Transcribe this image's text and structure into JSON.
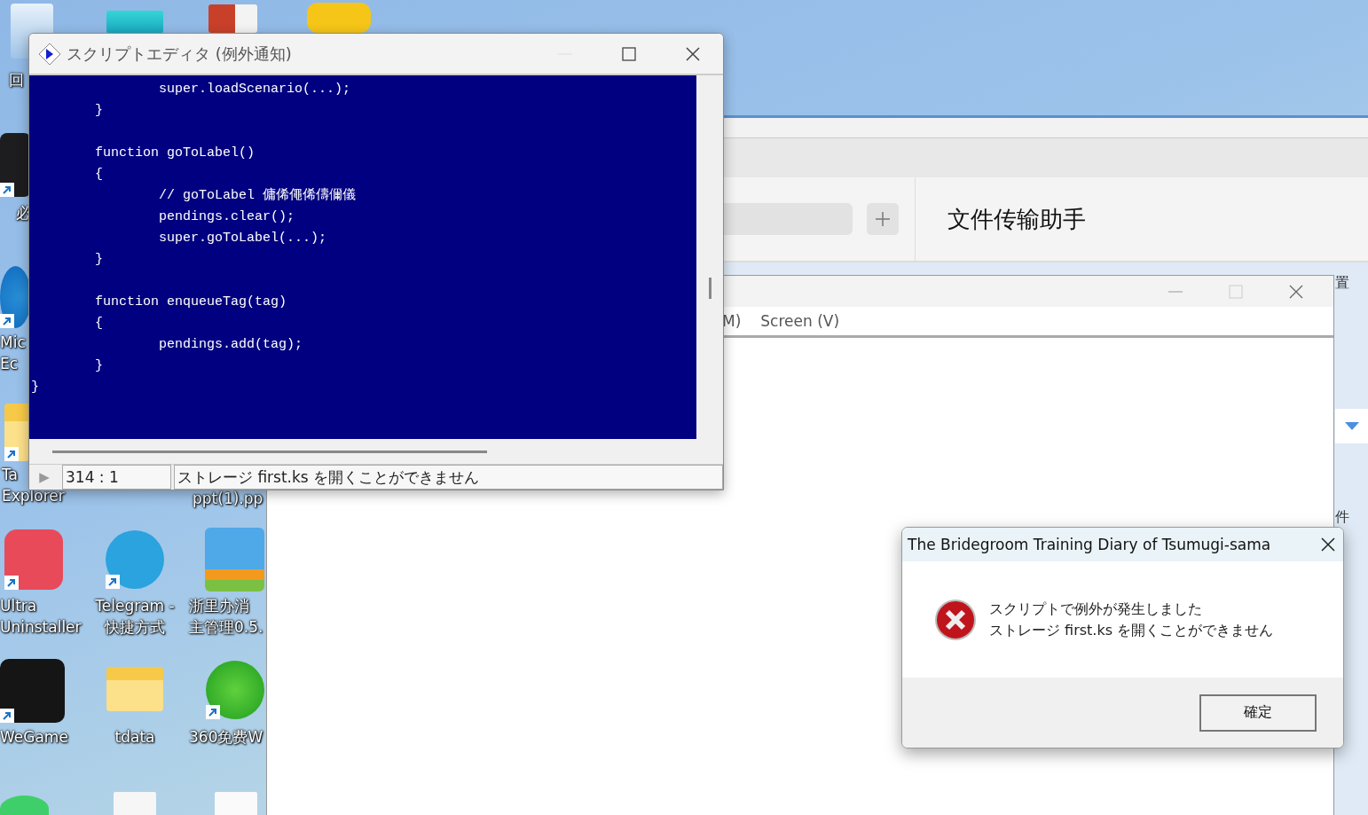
{
  "desktop_icons": [
    {
      "kind": "recycle-bin",
      "label_lines": [
        "回"
      ],
      "shortcut": false
    },
    {
      "kind": "tile",
      "shortcut": false
    },
    {
      "kind": "slides",
      "shortcut": false
    },
    {
      "kind": "stack",
      "shortcut": false
    },
    {
      "kind": "dark-app",
      "label_lines": [
        "必"
      ],
      "shortcut": true
    },
    {
      "kind": "browser",
      "label_lines": [
        "Mic",
        "Ec"
      ],
      "shortcut": true
    },
    {
      "kind": "folder",
      "label_lines": [
        "Ta",
        "Explorer"
      ],
      "shortcut": true
    },
    {
      "kind": "none",
      "label_lines": [
        "ppt(1).pp"
      ]
    },
    {
      "kind": "bolt",
      "label_lines": [
        "Ultra",
        "Uninstaller"
      ],
      "shortcut": true
    },
    {
      "kind": "plane",
      "label_lines": [
        "Telegram -",
        "快捷方式"
      ],
      "shortcut": true
    },
    {
      "kind": "zip",
      "label_lines": [
        "浙里办消",
        "主管理0.5."
      ],
      "shortcut": false
    },
    {
      "kind": "game",
      "label_lines": [
        "WeGame"
      ],
      "shortcut": true
    },
    {
      "kind": "folder",
      "label_lines": [
        "tdata"
      ],
      "shortcut": false
    },
    {
      "kind": "wifi",
      "label_lines": [
        "360免费W"
      ],
      "shortcut": true
    },
    {
      "kind": "chat",
      "shortcut": false
    },
    {
      "kind": "document",
      "shortcut": false
    },
    {
      "kind": "sheet",
      "shortcut": false
    }
  ],
  "chat_window": {
    "title": "文件传输助手",
    "side_texts": [
      "置",
      "件"
    ]
  },
  "game_window": {
    "menu": [
      "M)",
      "Screen (V)"
    ]
  },
  "script_editor": {
    "title": "スクリプトエディタ (例外通知)",
    "code_lines": [
      {
        "text": "\t\tsuper.loadScenario(...);",
        "blank_before": false
      },
      {
        "text": "\t}",
        "blank_before": false
      },
      {
        "text": "\tfunction goToLabel()",
        "blank_before": true
      },
      {
        "text": "\t{",
        "blank_before": false
      },
      {
        "text": "\t\t// goToLabel 傭俙僶俙儔儞儀",
        "blank_before": false
      },
      {
        "text": "\t\tpendings.clear();",
        "blank_before": false
      },
      {
        "text": "\t\tsuper.goToLabel(...);",
        "blank_before": false
      },
      {
        "text": "\t}",
        "blank_before": false
      },
      {
        "text": "\tfunction enqueueTag(tag)",
        "blank_before": true
      },
      {
        "text": "\t{",
        "blank_before": false
      },
      {
        "text": "\t\tpendings.add(tag);",
        "blank_before": false
      },
      {
        "text": "\t}",
        "blank_before": false
      },
      {
        "text": "}",
        "blank_before": false
      }
    ],
    "status_marker": "▶",
    "position": "314 : 1",
    "message": "ストレージ first.ks を開くことができません"
  },
  "dialog": {
    "title": "The Bridegroom Training Diary of Tsumugi-sama",
    "messages": [
      "スクリプトで例外が発生しました",
      "ストレージ first.ks を開くことができません"
    ],
    "button": "確定"
  }
}
